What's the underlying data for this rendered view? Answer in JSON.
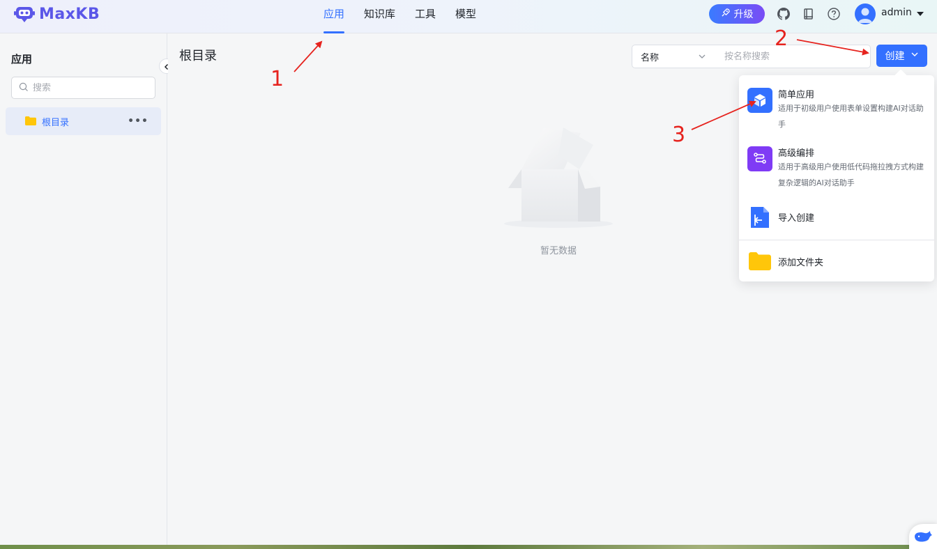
{
  "app": {
    "name": "MaxKB"
  },
  "nav": {
    "items": [
      {
        "label": "应用",
        "active": true
      },
      {
        "label": "知识库"
      },
      {
        "label": "工具"
      },
      {
        "label": "模型"
      }
    ]
  },
  "header": {
    "upgrade_label": "升级",
    "username": "admin",
    "icons": [
      "github-icon",
      "book-icon",
      "help-icon"
    ]
  },
  "sidebar": {
    "title": "应用",
    "search_placeholder": "搜索",
    "tree": [
      {
        "label": "根目录",
        "more": "•••"
      }
    ]
  },
  "main": {
    "title": "根目录",
    "filter": {
      "field": "名称",
      "placeholder": "按名称搜索"
    },
    "create_label": "创建",
    "empty_text": "暂无数据"
  },
  "dropdown": {
    "items": [
      {
        "title": "简单应用",
        "desc": "适用于初级用户使用表单设置构建AI对话助手",
        "icon": "cube-icon",
        "color": "#3370ff"
      },
      {
        "title": "高级编排",
        "desc": "适用于高级用户使用低代码拖拉拽方式构建复杂逻辑的AI对话助手",
        "icon": "workflow-icon",
        "color": "#7f3bf5"
      },
      {
        "title": "导入创建",
        "icon": "import-file-icon",
        "color": "#3370ff"
      },
      {
        "title": "添加文件夹",
        "icon": "folder-icon",
        "color": "#ffc60a"
      }
    ]
  },
  "annotations": {
    "labels": [
      "1",
      "2",
      "3"
    ],
    "color": "#e6231e"
  }
}
